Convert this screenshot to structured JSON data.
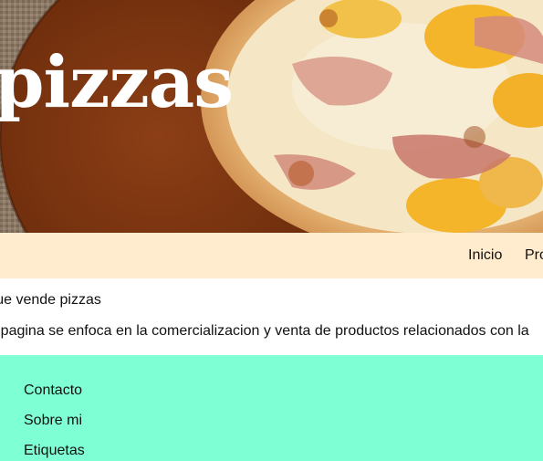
{
  "header": {
    "title": "pizzas"
  },
  "nav": {
    "items": [
      {
        "label": "Inicio"
      },
      {
        "label": "Pro"
      }
    ]
  },
  "main": {
    "tagline": "a que vende pizzas",
    "description": "ra pagina se enfoca en la comercializacion y venta de productos relacionados con la"
  },
  "footer": {
    "links": [
      {
        "label": "Contacto"
      },
      {
        "label": "Sobre mi"
      },
      {
        "label": "Etiquetas"
      }
    ]
  },
  "colors": {
    "navbar_bg": "#ffebcd",
    "footer_bg": "#7fffd4",
    "text": "#111111"
  }
}
